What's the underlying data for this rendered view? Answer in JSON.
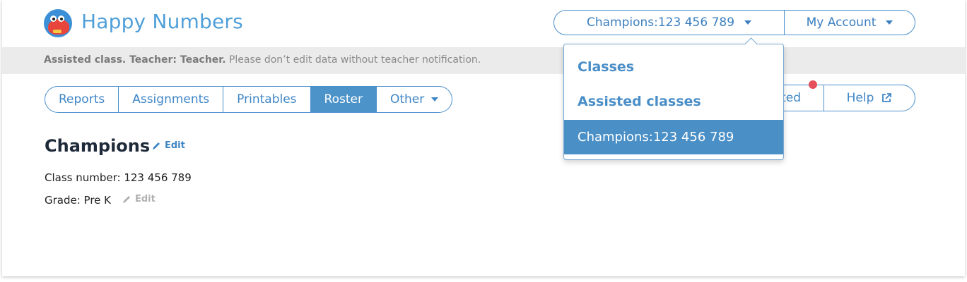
{
  "header": {
    "brand": "Happy Numbers",
    "class_selector": "Champions:123 456 789",
    "my_account": "My Account"
  },
  "notice": {
    "bold": "Assisted class. Teacher: Teacher.",
    "text": " Please don’t edit data without teacher notification."
  },
  "tabs": [
    {
      "label": "Reports"
    },
    {
      "label": "Assignments"
    },
    {
      "label": "Printables"
    },
    {
      "label": "Roster",
      "active": true
    },
    {
      "label": "Other"
    }
  ],
  "right_group": {
    "partial_label": "ted",
    "help": "Help"
  },
  "class_info": {
    "title": "Champions",
    "edit": "Edit",
    "class_number": "Class number: 123 456 789",
    "grade": "Grade: Pre K",
    "grade_edit": "Edit"
  },
  "dropdown": {
    "items": [
      {
        "label": "Classes"
      },
      {
        "label": "Assisted classes"
      },
      {
        "label": "Champions:123 456 789",
        "selected": true
      }
    ]
  },
  "colors": {
    "accent": "#4a8fc6",
    "brand": "#4f9fd9",
    "notification_dot": "#e5505a",
    "notice_bg": "#ebebeb"
  }
}
